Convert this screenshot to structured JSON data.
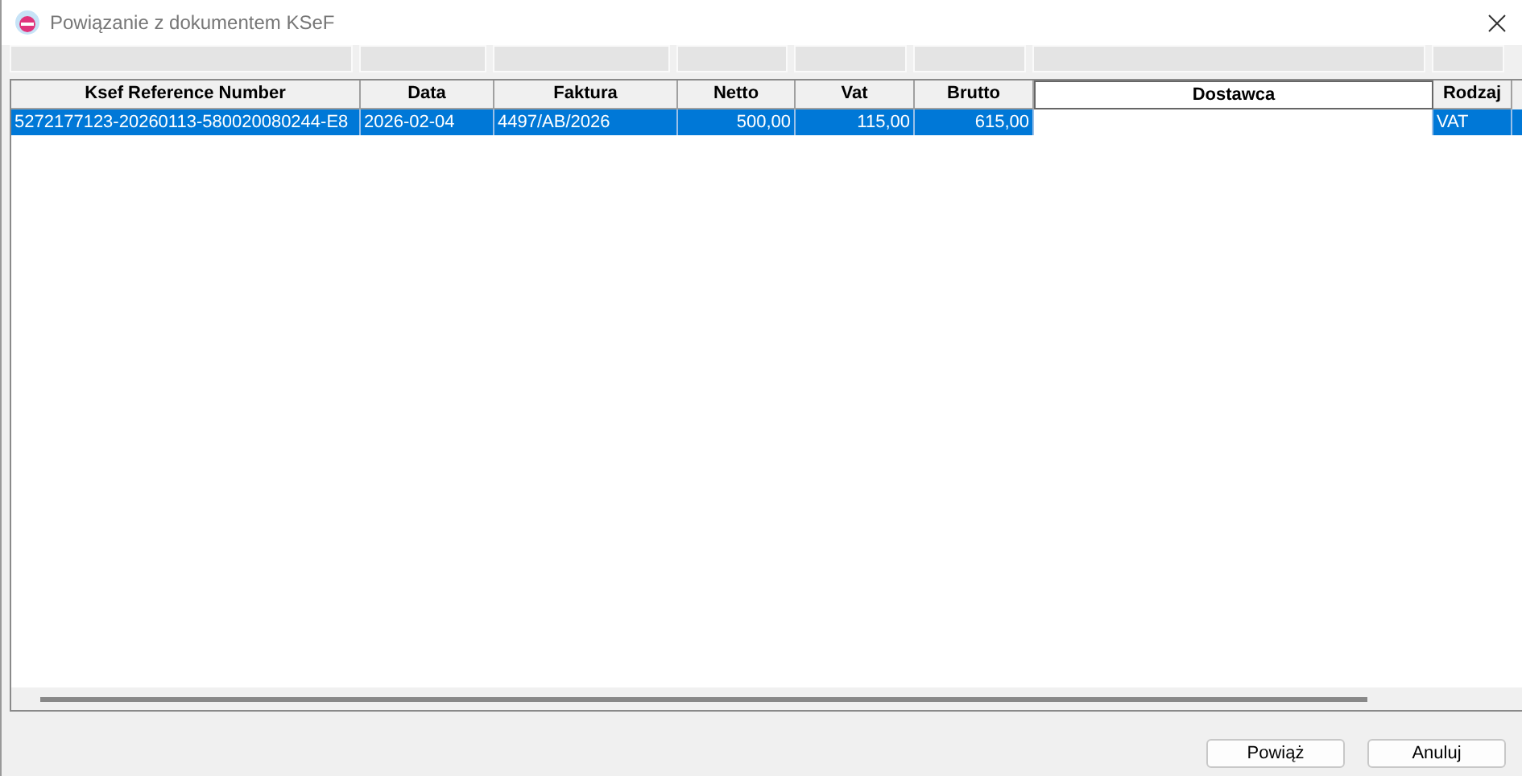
{
  "window": {
    "title": "Powiązanie z dokumentem KSeF"
  },
  "table": {
    "columns": [
      {
        "label": "Ksef Reference Number",
        "kind": "text"
      },
      {
        "label": "Data",
        "kind": "text"
      },
      {
        "label": "Faktura",
        "kind": "text"
      },
      {
        "label": "Netto",
        "kind": "number"
      },
      {
        "label": "Vat",
        "kind": "number"
      },
      {
        "label": "Brutto",
        "kind": "number"
      },
      {
        "label": "Dostawca",
        "kind": "hidden"
      },
      {
        "label": "Rodzaj",
        "kind": "text"
      }
    ],
    "rows": [
      {
        "selected": true,
        "cells": [
          "5272177123-20260113-580020080244-E8",
          "2026-02-04",
          "4497/AB/2026",
          "500,00",
          "115,00",
          "615,00",
          "",
          "VAT"
        ]
      }
    ]
  },
  "buttons": [
    "Powiąż",
    "Anuluj"
  ]
}
